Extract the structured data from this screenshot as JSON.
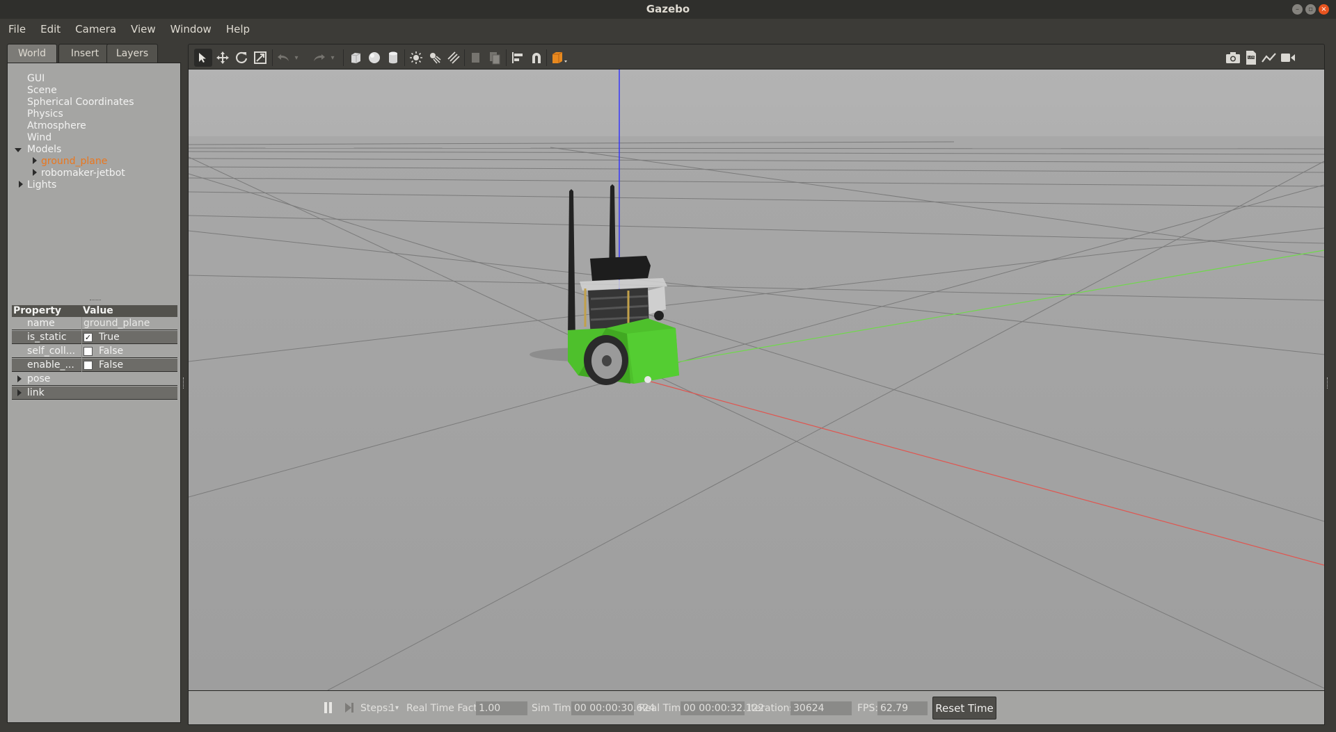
{
  "window": {
    "title": "Gazebo"
  },
  "menu": {
    "items": [
      "File",
      "Edit",
      "Camera",
      "View",
      "Window",
      "Help"
    ]
  },
  "left_panel": {
    "tabs": [
      "World",
      "Insert",
      "Layers"
    ],
    "tree": {
      "top_items": [
        "GUI",
        "Scene",
        "Spherical Coordinates",
        "Physics",
        "Atmosphere",
        "Wind"
      ],
      "models_label": "Models",
      "models": [
        "ground_plane",
        "robomaker-jetbot"
      ],
      "lights_label": "Lights"
    },
    "properties": {
      "header_property": "Property",
      "header_value": "Value",
      "rows": [
        {
          "key": "name",
          "value": "ground_plane"
        },
        {
          "key": "is_static",
          "value": "True",
          "checked": true
        },
        {
          "key": "self_coll...",
          "value": "False",
          "checked": false
        },
        {
          "key": "enable_...",
          "value": "False",
          "checked": false
        }
      ],
      "groups": [
        "pose",
        "link"
      ]
    }
  },
  "toolbar": {
    "icons": [
      "select-arrow",
      "translate",
      "rotate",
      "scale",
      "undo",
      "redo",
      "box",
      "sphere",
      "cylinder",
      "point-light",
      "spot-light",
      "directional-light",
      "copy",
      "paste",
      "align",
      "snap",
      "view-angle",
      "screenshot",
      "log",
      "plot",
      "video"
    ]
  },
  "status_bar": {
    "steps_label": "Steps:",
    "steps_value": "1",
    "rtf_label": "Real Time Factor:",
    "rtf_value": "1.00",
    "sim_time_label": "Sim Time:",
    "sim_time_value": "00 00:00:30.624",
    "real_time_label": "Real Time:",
    "real_time_value": "00 00:00:32.122",
    "iterations_label": "Iterations:",
    "iterations_value": "30624",
    "fps_label": "FPS:",
    "fps_value": "62.79",
    "reset_label": "Reset Time"
  },
  "colors": {
    "selected_model": "#e9771f",
    "x_axis": "#d9534f",
    "y_axis": "#5cb85c",
    "z_axis": "#3333ff",
    "robot_body": "#4ec02c"
  }
}
